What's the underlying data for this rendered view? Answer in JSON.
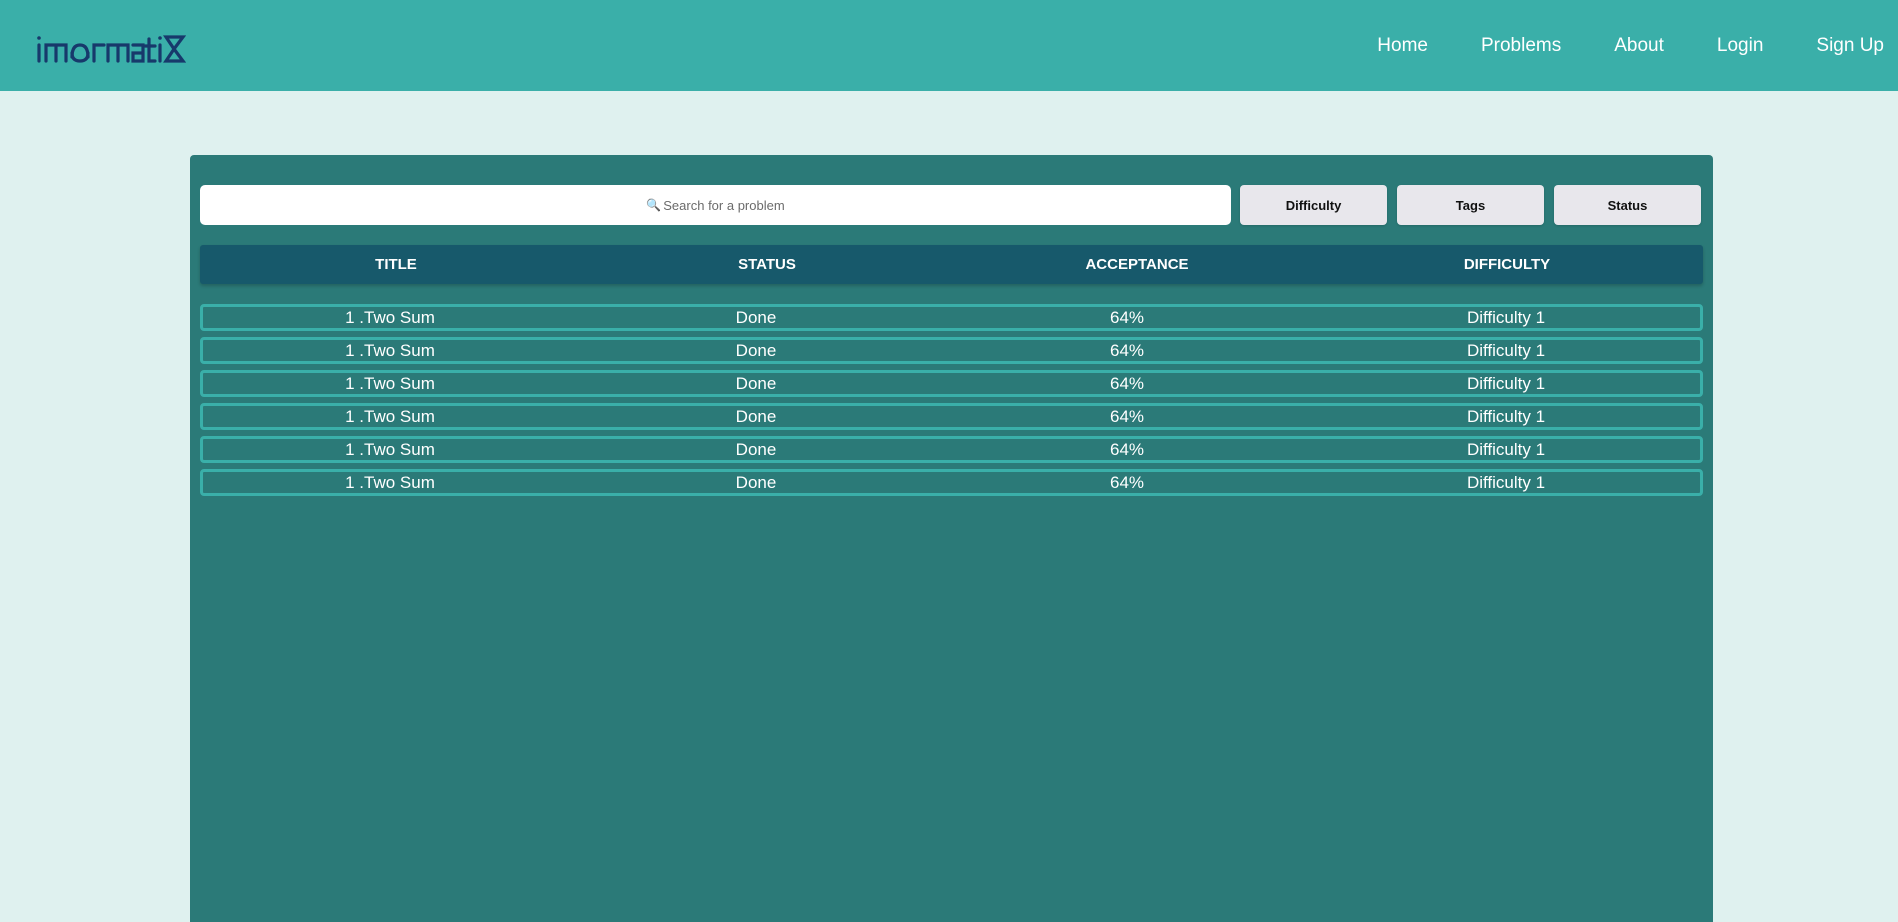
{
  "nav": {
    "logo_text": "imormatix",
    "links": [
      "Home",
      "Problems",
      "About",
      "Login",
      "Sign Up"
    ]
  },
  "toolbar": {
    "search_placeholder": "Search for a problem",
    "search_icon": "magnifier-icon",
    "difficulty_label": "Difficulty",
    "tags_label": "Tags",
    "status_label": "Status"
  },
  "table": {
    "headers": [
      "TITLE",
      "STATUS",
      "ACCEPTANCE",
      "DIFFICULTY"
    ],
    "rows": [
      [
        "1 .Two Sum",
        "Done",
        "64%",
        "Difficulty 1"
      ],
      [
        "1 .Two Sum",
        "Done",
        "64%",
        "Difficulty 1"
      ],
      [
        "1 .Two Sum",
        "Done",
        "64%",
        "Difficulty 1"
      ],
      [
        "1 .Two Sum",
        "Done",
        "64%",
        "Difficulty 1"
      ],
      [
        "1 .Two Sum",
        "Done",
        "64%",
        "Difficulty 1"
      ],
      [
        "1 .Two Sum",
        "Done",
        "64%",
        "Difficulty 1"
      ]
    ]
  },
  "colors": {
    "navbar": "#3aafa9",
    "page_bg": "#dff1ef",
    "panel": "#2b7a78",
    "header_row": "#17596b",
    "row_border": "#3aafa9",
    "logo": "#17396b"
  }
}
